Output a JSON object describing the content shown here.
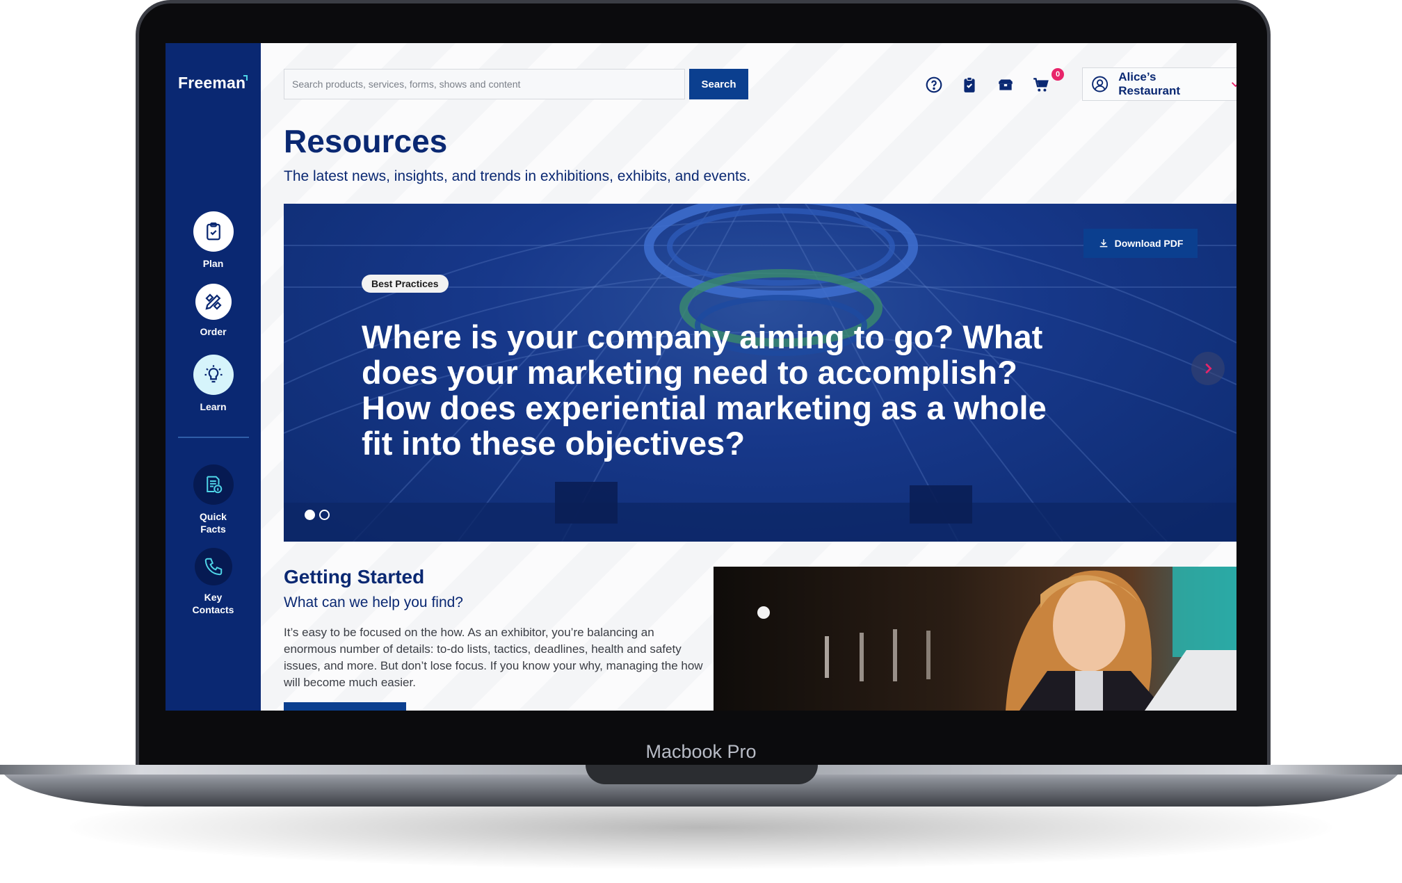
{
  "device": {
    "label": "Macbook Pro"
  },
  "sidebar": {
    "logo": "Freeman",
    "items": [
      {
        "label": "Plan"
      },
      {
        "label": "Order"
      },
      {
        "label": "Learn"
      },
      {
        "label_line1": "Quick",
        "label_line2": "Facts"
      },
      {
        "label_line1": "Key",
        "label_line2": "Contacts"
      }
    ]
  },
  "header": {
    "search_placeholder": "Search products, services, forms, shows and content",
    "search_button": "Search",
    "cart_count": "0",
    "account_name": "Alice’s Restaurant",
    "icons": [
      "help-icon",
      "clipboard-icon",
      "box-icon",
      "cart-icon",
      "user-icon",
      "chevron-down-icon"
    ]
  },
  "page": {
    "title": "Resources",
    "subtitle": "The latest news, insights, and trends in exhibitions, exhibits, and events."
  },
  "hero": {
    "tag": "Best Practices",
    "headline": "Where is your company aiming to go? What does your marketing need to accomplish? How does experiential marketing as a whole fit into these objectives?",
    "download_label": "Download PDF",
    "slides_total": 2,
    "active_slide": 1
  },
  "getting_started": {
    "title": "Getting Started",
    "subtitle": "What can we help you find?",
    "body": "It’s easy to be focused on the how. As an exhibitor, you’re balancing an enormous number of details: to-do lists, tactics, deadlines, health and safety issues, and more. But don’t lose focus. If you know your why, managing the how will become much easier."
  },
  "colors": {
    "brand_navy": "#0a2872",
    "button_blue": "#0b3f8f",
    "accent_cyan": "#4fd6e8",
    "badge_pink": "#e8246a"
  }
}
